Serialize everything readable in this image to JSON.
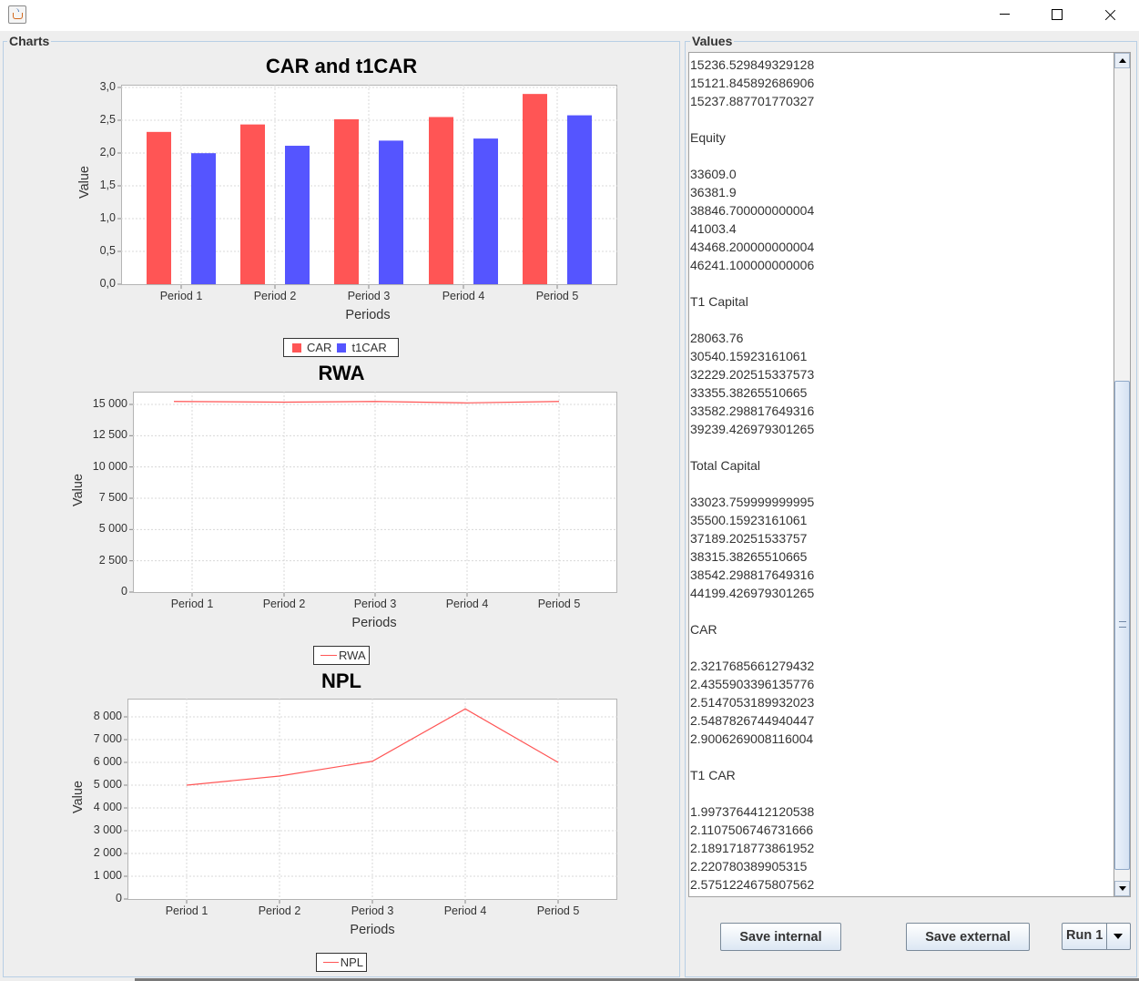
{
  "window": {
    "title": "",
    "minimize_icon": "minimize-icon",
    "maximize_icon": "maximize-icon",
    "close_icon": "close-icon"
  },
  "panels": {
    "charts_title": "Charts",
    "values_title": "Values"
  },
  "charts": [
    {
      "id": "car",
      "title": "CAR and t1CAR",
      "type": "bar",
      "xlabel": "Periods",
      "ylabel": "Value",
      "y_ticks": [
        "3,0",
        "2,5",
        "2,0",
        "1,5",
        "1,0",
        "0,5",
        "0,0"
      ]
    },
    {
      "id": "rwa",
      "title": "RWA",
      "type": "line",
      "xlabel": "Periods",
      "ylabel": "Value",
      "y_ticks": [
        "15 000",
        "12 500",
        "10 000",
        "7 500",
        "5 000",
        "2 500",
        "0"
      ]
    },
    {
      "id": "npl",
      "title": "NPL",
      "type": "line",
      "xlabel": "Periods",
      "ylabel": "Value",
      "y_ticks": [
        "8 000",
        "7 000",
        "6 000",
        "5 000",
        "4 000",
        "3 000",
        "2 000",
        "1 000",
        "0"
      ]
    }
  ],
  "chart_data": [
    {
      "type": "bar",
      "title": "CAR and t1CAR",
      "xlabel": "Periods",
      "ylabel": "Value",
      "categories": [
        "Period 1",
        "Period 2",
        "Period 3",
        "Period 4",
        "Period 5"
      ],
      "series": [
        {
          "name": "CAR",
          "color": "#ff5555",
          "values": [
            2.3217685661279432,
            2.4355903396135776,
            2.5147053189932023,
            2.5487826744940447,
            2.9006269008116004
          ]
        },
        {
          "name": "t1CAR",
          "color": "#5555ff",
          "values": [
            1.9973764412120538,
            2.1107506746731666,
            2.1891718773861952,
            2.220780389905315,
            2.5751224675807562
          ]
        }
      ],
      "ylim": [
        0,
        3.0
      ],
      "grid": true,
      "legend": "bottom"
    },
    {
      "type": "line",
      "title": "RWA",
      "xlabel": "Periods",
      "ylabel": "Value",
      "categories": [
        "Period 1",
        "Period 2",
        "Period 3",
        "Period 4",
        "Period 5"
      ],
      "series": [
        {
          "name": "RWA",
          "color": "#ff5555",
          "values": [
            15237.9,
            15180,
            15236.529849329128,
            15121.845892686906,
            15237.887701770327
          ]
        }
      ],
      "ylim": [
        0,
        16000
      ],
      "grid": true,
      "legend": "bottom"
    },
    {
      "type": "line",
      "title": "NPL",
      "xlabel": "Periods",
      "ylabel": "Value",
      "categories": [
        "Period 1",
        "Period 2",
        "Period 3",
        "Period 4",
        "Period 5"
      ],
      "series": [
        {
          "name": "NPL",
          "color": "#ff5555",
          "values": [
            5000,
            5400,
            6050,
            8350,
            6000
          ]
        }
      ],
      "ylim": [
        0,
        8400
      ],
      "grid": true,
      "legend": "bottom"
    }
  ],
  "values_text": "15236.529849329128\n15121.845892686906\n15237.887701770327\n\nEquity\n\n33609.0\n36381.9\n38846.700000000004\n41003.4\n43468.200000000004\n46241.100000000006\n\nT1 Capital\n\n28063.76\n30540.15923161061\n32229.202515337573\n33355.38265510665\n33582.298817649316\n39239.426979301265\n\nTotal Capital\n\n33023.759999999995\n35500.15923161061\n37189.20251533757\n38315.38265510665\n38542.298817649316\n44199.426979301265\n\nCAR\n\n2.3217685661279432\n2.4355903396135776\n2.5147053189932023\n2.5487826744940447\n2.9006269008116004\n\nT1 CAR\n\n1.9973764412120538\n2.1107506746731666\n2.1891718773861952\n2.220780389905315\n2.5751224675807562",
  "buttons": {
    "save_internal": "Save internal",
    "save_external": "Save external"
  },
  "run_select": {
    "value": "Run 1"
  }
}
